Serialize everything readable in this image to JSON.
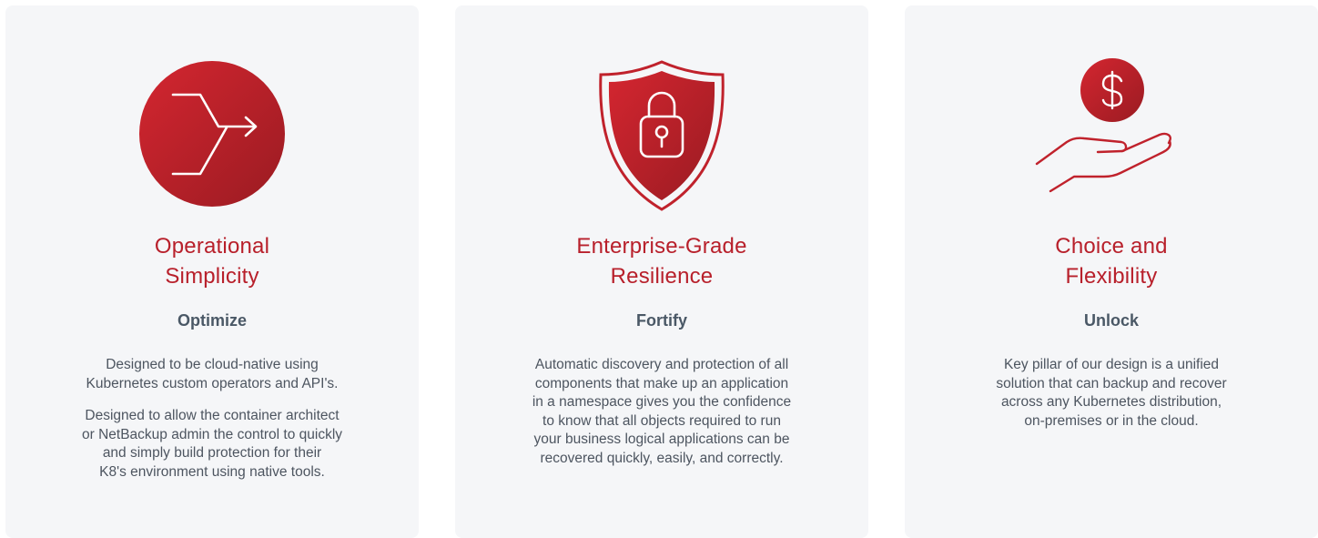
{
  "colors": {
    "accent_red": "#b8202b",
    "accent_red_dark": "#9c1c24",
    "heading_slate": "#4a5866",
    "body_text": "#4d5560",
    "card_bg": "#f5f6f8"
  },
  "cards": [
    {
      "icon": "arrow-merge-icon",
      "title_lines": [
        "Operational",
        "Simplicity"
      ],
      "subtitle": "Optimize",
      "paragraphs": [
        [
          "Designed to be cloud-native using",
          "Kubernetes custom operators and API's."
        ],
        [
          "Designed to allow the container architect",
          "or NetBackup admin the control to quickly",
          "and simply build protection for their",
          "K8's environment using native tools."
        ]
      ]
    },
    {
      "icon": "shield-lock-icon",
      "title_lines": [
        "Enterprise-Grade",
        "Resilience"
      ],
      "subtitle": "Fortify",
      "paragraphs": [
        [
          "Automatic discovery and protection of all",
          "components that make up an application",
          "in a namespace gives you the confidence",
          "to know that all objects required to run",
          "your business logical applications can be",
          "recovered quickly, easily, and correctly."
        ]
      ]
    },
    {
      "icon": "hand-dollar-icon",
      "title_lines": [
        "Choice and",
        "Flexibility"
      ],
      "subtitle": "Unlock",
      "paragraphs": [
        [
          "Key pillar of our design is a unified",
          "solution that can backup and recover",
          "across any Kubernetes distribution,",
          "on-premises or in the cloud."
        ]
      ]
    }
  ]
}
